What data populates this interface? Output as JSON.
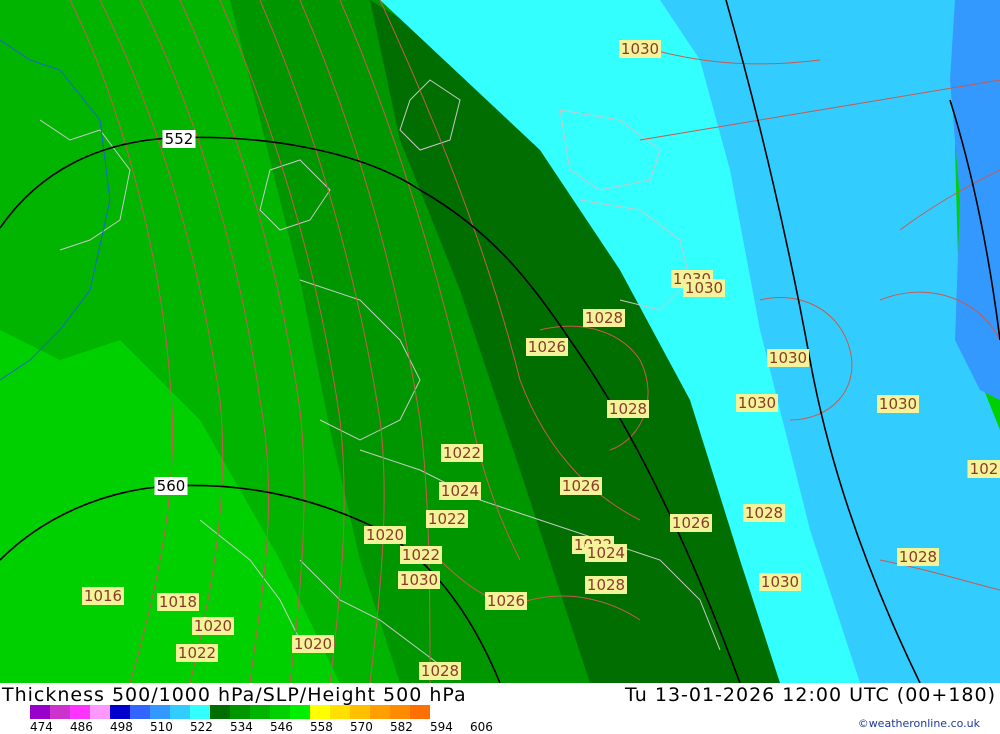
{
  "title": "Thickness 500/1000 hPa/SLP/Height 500 hPa",
  "datetime": "Tu 13-01-2026 12:00 UTC (00+180)",
  "credit": "©weatheronline.co.uk",
  "colors": {
    "lime_light": "#00d000",
    "green_mid": "#00b400",
    "green": "#009600",
    "green_dark": "#006e00",
    "cyan": "#33ffff",
    "sky": "#33ccff",
    "blue": "#3399ff",
    "contour_slp": "#c85a50",
    "contour_height": "#000000",
    "coastline": "#c8c8c8"
  },
  "height_labels": [
    {
      "text": "552"
    },
    {
      "text": "560"
    }
  ],
  "pressure_labels": [
    {
      "text": "1030"
    },
    {
      "text": "1030"
    },
    {
      "text": "1030"
    },
    {
      "text": "1028"
    },
    {
      "text": "1026"
    },
    {
      "text": "1030"
    },
    {
      "text": "1028"
    },
    {
      "text": "1030"
    },
    {
      "text": "1030"
    },
    {
      "text": "1022"
    },
    {
      "text": "1026"
    },
    {
      "text": "102"
    },
    {
      "text": "1024"
    },
    {
      "text": "1022"
    },
    {
      "text": "1028"
    },
    {
      "text": "1026"
    },
    {
      "text": "1020"
    },
    {
      "text": "1022"
    },
    {
      "text": "1022"
    },
    {
      "text": "1024"
    },
    {
      "text": "1030"
    },
    {
      "text": "1028"
    },
    {
      "text": "1030"
    },
    {
      "text": "1028"
    },
    {
      "text": "1016"
    },
    {
      "text": "1018"
    },
    {
      "text": "1026"
    },
    {
      "text": "1020"
    },
    {
      "text": "1022"
    },
    {
      "text": "1020"
    },
    {
      "text": "1028"
    }
  ],
  "scale": {
    "labels": [
      "474",
      "486",
      "498",
      "510",
      "522",
      "534",
      "546",
      "558",
      "570",
      "582",
      "594",
      "606"
    ],
    "colors": [
      "#9900cc",
      "#cc33cc",
      "#ff33ff",
      "#ff99ff",
      "#0000cc",
      "#3366ff",
      "#3399ff",
      "#33ccff",
      "#33ffff",
      "#006e00",
      "#009600",
      "#00b400",
      "#00d000",
      "#00f000",
      "#ffff00",
      "#ffe000",
      "#ffc000",
      "#ffa000",
      "#ff8c00",
      "#ff7000"
    ]
  }
}
